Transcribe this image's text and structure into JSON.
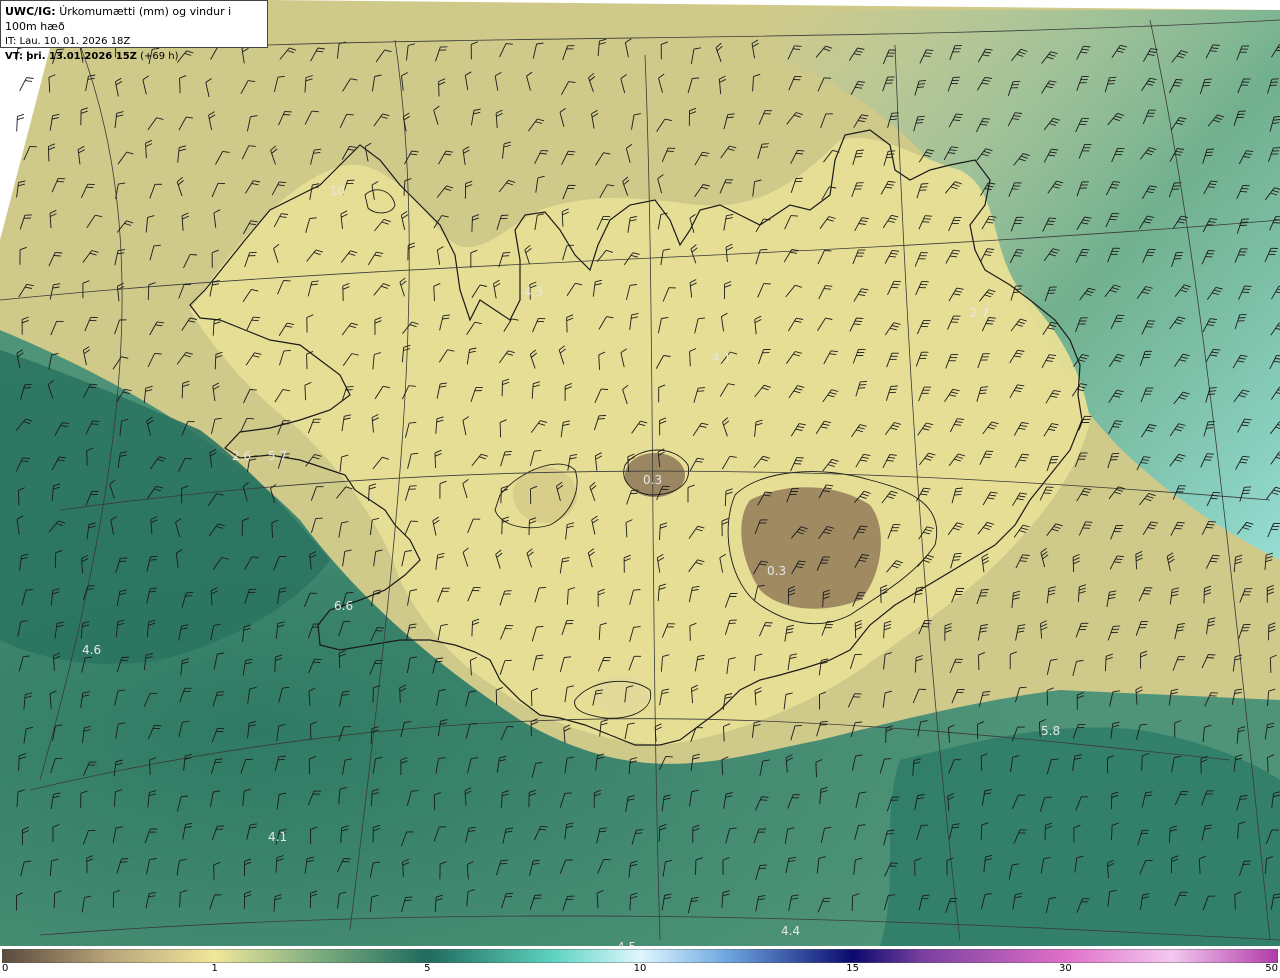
{
  "header": {
    "model": "UWC/IG:",
    "title": "Úrkomumætti (mm) og vindur i 100m hæð",
    "init_time": "IT: Lau. 10. 01. 2026 18Z",
    "valid_prefix": "VT:",
    "valid_time": "þri. 13.01.2026 15Z",
    "lead": "(+69 h)"
  },
  "map_labels": [
    {
      "text": "10"
    },
    {
      "text": "4.3"
    },
    {
      "text": "4.1"
    },
    {
      "text": "2.7"
    },
    {
      "text": "2.6"
    },
    {
      "text": "5.7"
    },
    {
      "text": "0.3"
    },
    {
      "text": "0.3"
    },
    {
      "text": "6.6"
    },
    {
      "text": "4.6"
    },
    {
      "text": "5.8"
    },
    {
      "text": "4.1"
    },
    {
      "text": "4.4"
    },
    {
      "text": "4.5"
    }
  ],
  "colorbar": {
    "ticks": [
      "0",
      "1",
      "5",
      "10",
      "15",
      "30",
      "50"
    ],
    "tick_values": [
      0,
      1,
      5,
      10,
      15,
      30,
      50
    ],
    "stops": [
      {
        "value": 0,
        "color": "#5a4a3c"
      },
      {
        "value": 0.5,
        "color": "#b8a47a"
      },
      {
        "value": 1,
        "color": "#efe79a"
      },
      {
        "value": 3,
        "color": "#7aab7e"
      },
      {
        "value": 5,
        "color": "#1f6b5e"
      },
      {
        "value": 8,
        "color": "#5fd4c0"
      },
      {
        "value": 10,
        "color": "#dff7ff"
      },
      {
        "value": 12,
        "color": "#6fa8e0"
      },
      {
        "value": 15,
        "color": "#0a0a6e"
      },
      {
        "value": 20,
        "color": "#7a40a0"
      },
      {
        "value": 30,
        "color": "#e070c8"
      },
      {
        "value": 40,
        "color": "#f2c8ee"
      },
      {
        "value": 50,
        "color": "#b03aa8"
      }
    ]
  },
  "colors": {
    "land_light": "#e8df96",
    "land_dry": "#9a8660",
    "sea_dark": "#2f7a64",
    "sea_mid": "#5a9a78",
    "ne_cyan": "#7fcfcf",
    "coast_line": "#1a1a1a",
    "grid_line": "#3a3a3a"
  }
}
